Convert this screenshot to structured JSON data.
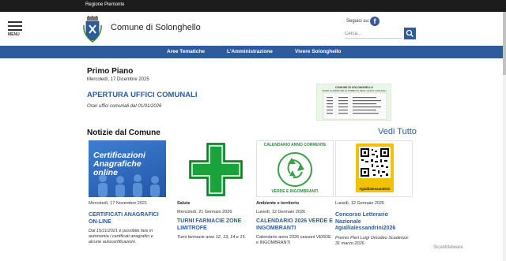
{
  "topbar": {
    "region": "Regione Piemonte"
  },
  "header": {
    "menu_label": "MENU",
    "title": "Comune di Solonghello",
    "follow_label": "Seguici su:",
    "fb_glyph": "f",
    "search_placeholder": "Cerca..."
  },
  "nav": {
    "items": [
      {
        "label": "Aree Tematiche"
      },
      {
        "label": "L'Amministrazione"
      },
      {
        "label": "Vivere Solonghello"
      }
    ]
  },
  "primo_piano": {
    "heading": "Primo Piano",
    "date": "Mercoledì, 17 Dicembre 2025",
    "title": "APERTURA UFFICI COMUNALI",
    "subtitle": "Orari uffici comunali dal 01/01/2026"
  },
  "orari_image": {
    "title": "COMUNE DI SOLONGHELLO",
    "subtitle": "ORARI DI APERTURA AL PUBBLICO DEGLI UFFICI COMUNALI"
  },
  "notizie": {
    "heading": "Notizie dal Comune",
    "more": "Vedi Tutto",
    "cards": [
      {
        "image_text": "Certificazioni Anagrafiche online",
        "category": "",
        "date": "Mercoledì, 17 Novembre 2021",
        "title": "CERTIFICATI ANAGRAFICI ON-LINE",
        "desc": "Dal 15/11/2021 è possibile fare in autonomia i certificati anagrafici e alcune autocertificazioni."
      },
      {
        "image_text": "",
        "category": "Salute",
        "date": "Mercoledì, 21 Gennaio 2026",
        "title": "TURNI FARMACIE ZONE LIMITROFE",
        "desc": "Turni farmacie aree 12, 13, 14 e 15."
      },
      {
        "image_text": "CALENDARIO ANNO CORRENTE",
        "image_text2": "VERDE E INGOMBRANTI",
        "category": "Ambiente e territorio",
        "date": "Lunedì, 12 Gennaio 2026",
        "title": "CALENDARIO 2026 VERDE E INGOMBRANTI",
        "desc": "Calendario anno 2026 cassoni VERDE e INGOMBRANTI"
      },
      {
        "image_text": "#giallialessandrini",
        "category": "",
        "date": "Lunedì, 12 Gennaio 2026",
        "title": "Concorso Letterario Nazionale #giallialessandrini2026",
        "desc": "Premio Pieri Luigi Omodeo Scadenza: 31 marzo 2026"
      }
    ]
  },
  "watermark": "SicanMalware",
  "colors": {
    "brand_blue": "#2b5c9e",
    "topbar": "#1c1c1c",
    "pharmacy_green": "#1aa33b"
  }
}
